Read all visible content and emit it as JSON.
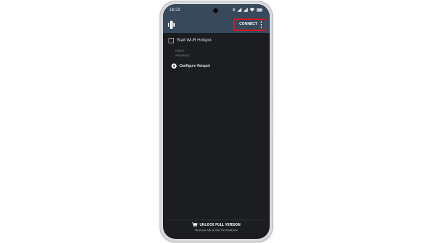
{
  "status_bar": {
    "time": "18:23",
    "battery": "battery-full-icon"
  },
  "toolbar": {
    "logo": "app-logo-icon",
    "connect_label": "CONNECT",
    "menu_icon": "more-vert-icon"
  },
  "hotspot": {
    "checkbox_label": "Start Wi-Fi Hotspot",
    "checked": false,
    "name_label": "Name:",
    "password_label": "Password:"
  },
  "configure": {
    "icon": "gear-icon",
    "label": "Configure Hotspot"
  },
  "unlock": {
    "icon": "cart-icon",
    "title": "UNLOCK FULL VERSION",
    "subtitle": "Remove Ads & Get Pro Features"
  },
  "colors": {
    "toolbar": "#37495b",
    "background": "#1b1d21",
    "highlight": "#e0151b"
  }
}
